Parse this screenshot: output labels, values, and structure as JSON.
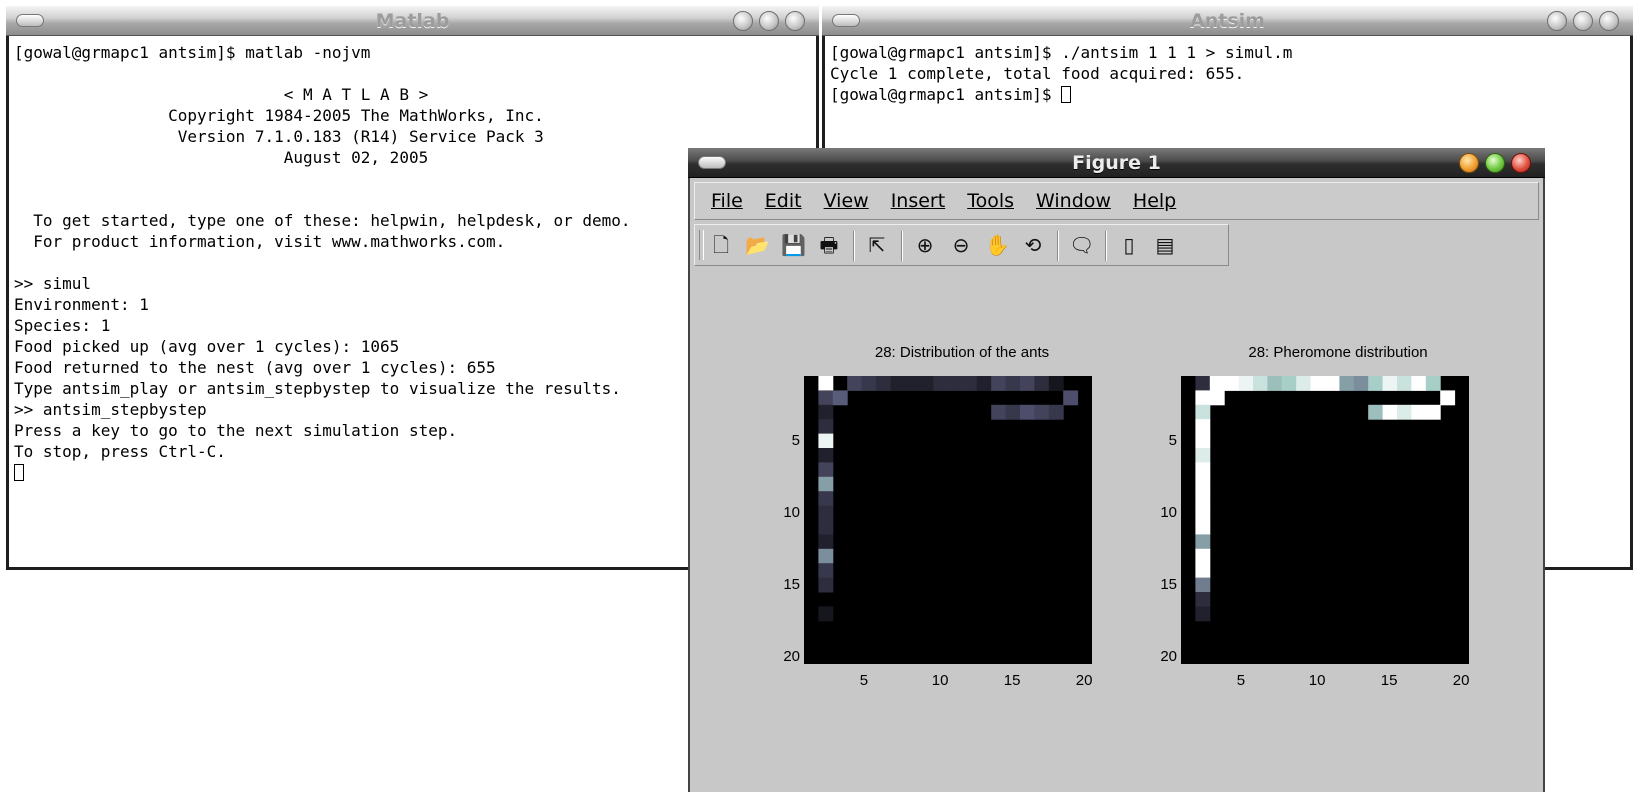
{
  "matlab_window": {
    "title": "Matlab",
    "lines": [
      "[gowal@grmapc1 antsim]$ matlab -nojvm",
      "",
      "                            < M A T L A B >",
      "                Copyright 1984-2005 The MathWorks, Inc.",
      "                 Version 7.1.0.183 (R14) Service Pack 3",
      "                            August 02, 2005",
      "",
      "",
      "  To get started, type one of these: helpwin, helpdesk, or demo.",
      "  For product information, visit www.mathworks.com.",
      "",
      ">> simul",
      "Environment: 1",
      "Species: 1",
      "Food picked up (avg over 1 cycles): 1065",
      "Food returned to the nest (avg over 1 cycles): 655",
      "Type antsim_play or antsim_stepbystep to visualize the results.",
      ">> antsim_stepbystep",
      "Press a key to go to the next simulation step.",
      "To stop, press Ctrl-C."
    ]
  },
  "antsim_window": {
    "title": "Antsim",
    "lines": [
      "[gowal@grmapc1 antsim]$ ./antsim 1 1 1 > simul.m",
      "Cycle 1 complete, total food acquired: 655.",
      "[gowal@grmapc1 antsim]$ "
    ]
  },
  "figure_window": {
    "title": "Figure 1",
    "menu": [
      "File",
      "Edit",
      "View",
      "Insert",
      "Tools",
      "Window",
      "Help"
    ],
    "toolbar_icons": [
      "new-file-icon",
      "open-folder-icon",
      "save-icon",
      "print-icon",
      "select-arrow-icon",
      "zoom-in-icon",
      "zoom-out-icon",
      "pan-hand-icon",
      "rotate-3d-icon",
      "data-cursor-icon",
      "colorbar-icon",
      "legend-icon"
    ]
  },
  "chart_data": [
    {
      "type": "heatmap",
      "title": "28: Distribution of the ants",
      "xlabel": "",
      "ylabel": "",
      "xticks": [
        5,
        10,
        15,
        20
      ],
      "yticks": [
        5,
        10,
        15,
        20
      ],
      "xlim": [
        1,
        20
      ],
      "ylim": [
        1,
        20
      ],
      "colormap": "bone",
      "cells": [
        {
          "row": 1,
          "col": 2,
          "v": 1.0
        },
        {
          "row": 1,
          "col": 4,
          "v": 0.3
        },
        {
          "row": 1,
          "col": 5,
          "v": 0.25
        },
        {
          "row": 1,
          "col": 6,
          "v": 0.2
        },
        {
          "row": 1,
          "col": 7,
          "v": 0.15
        },
        {
          "row": 1,
          "col": 8,
          "v": 0.15
        },
        {
          "row": 1,
          "col": 9,
          "v": 0.15
        },
        {
          "row": 1,
          "col": 10,
          "v": 0.2
        },
        {
          "row": 1,
          "col": 11,
          "v": 0.2
        },
        {
          "row": 1,
          "col": 12,
          "v": 0.2
        },
        {
          "row": 1,
          "col": 13,
          "v": 0.15
        },
        {
          "row": 1,
          "col": 14,
          "v": 0.3
        },
        {
          "row": 1,
          "col": 15,
          "v": 0.25
        },
        {
          "row": 1,
          "col": 16,
          "v": 0.3
        },
        {
          "row": 1,
          "col": 17,
          "v": 0.2
        },
        {
          "row": 1,
          "col": 18,
          "v": 0.1
        },
        {
          "row": 2,
          "col": 2,
          "v": 0.3
        },
        {
          "row": 2,
          "col": 3,
          "v": 0.4
        },
        {
          "row": 2,
          "col": 19,
          "v": 0.35
        },
        {
          "row": 3,
          "col": 2,
          "v": 0.15
        },
        {
          "row": 3,
          "col": 14,
          "v": 0.3
        },
        {
          "row": 3,
          "col": 15,
          "v": 0.25
        },
        {
          "row": 3,
          "col": 16,
          "v": 0.35
        },
        {
          "row": 3,
          "col": 17,
          "v": 0.3
        },
        {
          "row": 3,
          "col": 18,
          "v": 0.25
        },
        {
          "row": 4,
          "col": 2,
          "v": 0.2
        },
        {
          "row": 5,
          "col": 2,
          "v": 0.95
        },
        {
          "row": 6,
          "col": 2,
          "v": 0.15
        },
        {
          "row": 7,
          "col": 2,
          "v": 0.3
        },
        {
          "row": 8,
          "col": 2,
          "v": 0.6
        },
        {
          "row": 9,
          "col": 2,
          "v": 0.25
        },
        {
          "row": 10,
          "col": 2,
          "v": 0.2
        },
        {
          "row": 11,
          "col": 2,
          "v": 0.2
        },
        {
          "row": 12,
          "col": 2,
          "v": 0.15
        },
        {
          "row": 13,
          "col": 2,
          "v": 0.55
        },
        {
          "row": 14,
          "col": 2,
          "v": 0.25
        },
        {
          "row": 15,
          "col": 2,
          "v": 0.2
        },
        {
          "row": 17,
          "col": 2,
          "v": 0.1
        }
      ]
    },
    {
      "type": "heatmap",
      "title": "28: Pheromone distribution",
      "xlabel": "",
      "ylabel": "",
      "xticks": [
        5,
        10,
        15,
        20
      ],
      "yticks": [
        5,
        10,
        15,
        20
      ],
      "xlim": [
        1,
        20
      ],
      "ylim": [
        1,
        20
      ],
      "colormap": "bone",
      "cells": [
        {
          "row": 1,
          "col": 2,
          "v": 0.2
        },
        {
          "row": 1,
          "col": 3,
          "v": 1.0
        },
        {
          "row": 1,
          "col": 4,
          "v": 1.0
        },
        {
          "row": 1,
          "col": 5,
          "v": 0.95
        },
        {
          "row": 1,
          "col": 6,
          "v": 0.85
        },
        {
          "row": 1,
          "col": 7,
          "v": 0.7
        },
        {
          "row": 1,
          "col": 8,
          "v": 0.75
        },
        {
          "row": 1,
          "col": 9,
          "v": 0.9
        },
        {
          "row": 1,
          "col": 10,
          "v": 1.0
        },
        {
          "row": 1,
          "col": 11,
          "v": 1.0
        },
        {
          "row": 1,
          "col": 12,
          "v": 0.6
        },
        {
          "row": 1,
          "col": 13,
          "v": 0.55
        },
        {
          "row": 1,
          "col": 14,
          "v": 0.75
        },
        {
          "row": 1,
          "col": 15,
          "v": 0.95
        },
        {
          "row": 1,
          "col": 16,
          "v": 0.85
        },
        {
          "row": 1,
          "col": 17,
          "v": 1.0
        },
        {
          "row": 1,
          "col": 18,
          "v": 0.75
        },
        {
          "row": 2,
          "col": 2,
          "v": 1.0
        },
        {
          "row": 2,
          "col": 3,
          "v": 1.0
        },
        {
          "row": 2,
          "col": 19,
          "v": 1.0
        },
        {
          "row": 3,
          "col": 2,
          "v": 0.85
        },
        {
          "row": 3,
          "col": 14,
          "v": 0.7
        },
        {
          "row": 3,
          "col": 15,
          "v": 1.0
        },
        {
          "row": 3,
          "col": 16,
          "v": 0.9
        },
        {
          "row": 3,
          "col": 17,
          "v": 1.0
        },
        {
          "row": 3,
          "col": 18,
          "v": 1.0
        },
        {
          "row": 4,
          "col": 2,
          "v": 1.0
        },
        {
          "row": 5,
          "col": 2,
          "v": 1.0
        },
        {
          "row": 6,
          "col": 2,
          "v": 0.9
        },
        {
          "row": 7,
          "col": 2,
          "v": 1.0
        },
        {
          "row": 8,
          "col": 2,
          "v": 1.0
        },
        {
          "row": 9,
          "col": 2,
          "v": 1.0
        },
        {
          "row": 10,
          "col": 2,
          "v": 1.0
        },
        {
          "row": 11,
          "col": 2,
          "v": 1.0
        },
        {
          "row": 12,
          "col": 2,
          "v": 0.6
        },
        {
          "row": 13,
          "col": 2,
          "v": 1.0
        },
        {
          "row": 14,
          "col": 2,
          "v": 1.0
        },
        {
          "row": 15,
          "col": 2,
          "v": 0.5
        },
        {
          "row": 16,
          "col": 2,
          "v": 0.2
        },
        {
          "row": 17,
          "col": 2,
          "v": 0.15
        }
      ]
    }
  ]
}
